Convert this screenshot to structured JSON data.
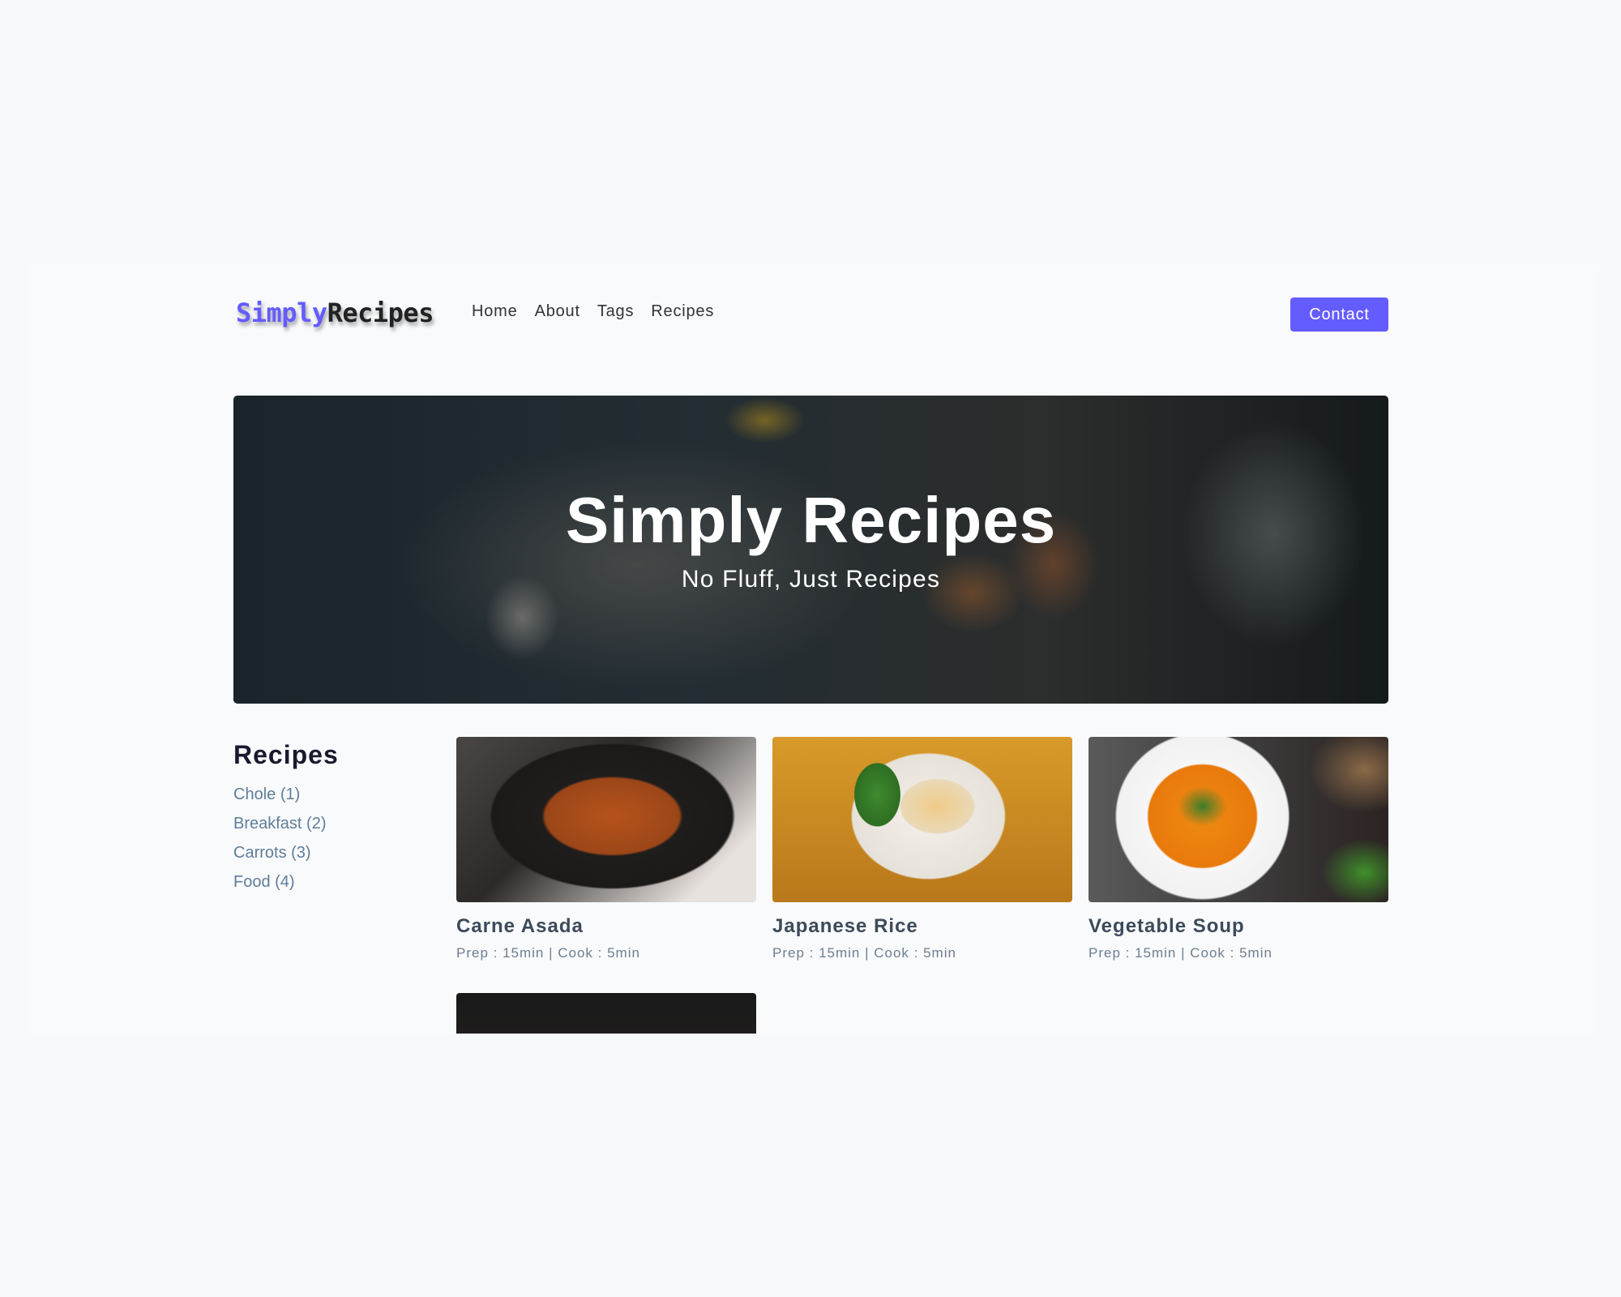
{
  "nav": {
    "logo_part1": "Simply",
    "logo_part2": "Recipes",
    "links": [
      "Home",
      "About",
      "Tags",
      "Recipes"
    ],
    "contact_label": "Contact",
    "accent_color": "#645cff"
  },
  "hero": {
    "title": "Simply Recipes",
    "subtitle": "No Fluff, Just Recipes"
  },
  "sidebar": {
    "title": "Recipes",
    "tags": [
      "Chole (1)",
      "Breakfast (2)",
      "Carrots (3)",
      "Food (4)"
    ]
  },
  "recipes": [
    {
      "name": "Carne Asada",
      "meta": "Prep : 15min | Cook : 5min"
    },
    {
      "name": "Japanese Rice",
      "meta": "Prep : 15min | Cook : 5min"
    },
    {
      "name": "Vegetable Soup",
      "meta": "Prep : 15min | Cook : 5min"
    }
  ]
}
